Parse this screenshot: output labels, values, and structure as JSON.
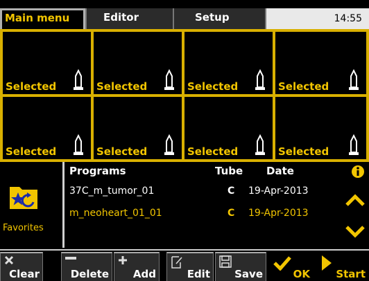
{
  "tabs": {
    "main_menu": "Main menu",
    "editor": "Editor",
    "setup": "Setup"
  },
  "clock": "14:55",
  "slots": [
    {
      "label": "Selected"
    },
    {
      "label": "Selected"
    },
    {
      "label": "Selected"
    },
    {
      "label": "Selected"
    },
    {
      "label": "Selected"
    },
    {
      "label": "Selected"
    },
    {
      "label": "Selected"
    },
    {
      "label": "Selected"
    }
  ],
  "favorites": {
    "label": "Favorites"
  },
  "programs": {
    "headers": {
      "programs": "Programs",
      "tube": "Tube",
      "date": "Date"
    },
    "rows": [
      {
        "name": "37C_m_tumor_01",
        "tube": "C",
        "date": "19-Apr-2013"
      },
      {
        "name": "m_neoheart_01_01",
        "tube": "C",
        "date": "19-Apr-2013"
      }
    ]
  },
  "toolbar": {
    "clear": "Clear",
    "delete": "Delete",
    "add": "Add",
    "edit": "Edit",
    "save": "Save",
    "ok": "OK",
    "start": "Start"
  },
  "colors": {
    "accent": "#f2c500",
    "grid_border": "#d9b000",
    "background": "#000000",
    "button_bg": "#2b2b2b"
  },
  "icons": [
    "tube-icon",
    "star-folder-icon",
    "info-icon",
    "chevron-up-icon",
    "chevron-down-icon",
    "x-icon",
    "minus-icon",
    "plus-icon",
    "edit-icon",
    "save-icon",
    "check-icon",
    "play-icon"
  ]
}
